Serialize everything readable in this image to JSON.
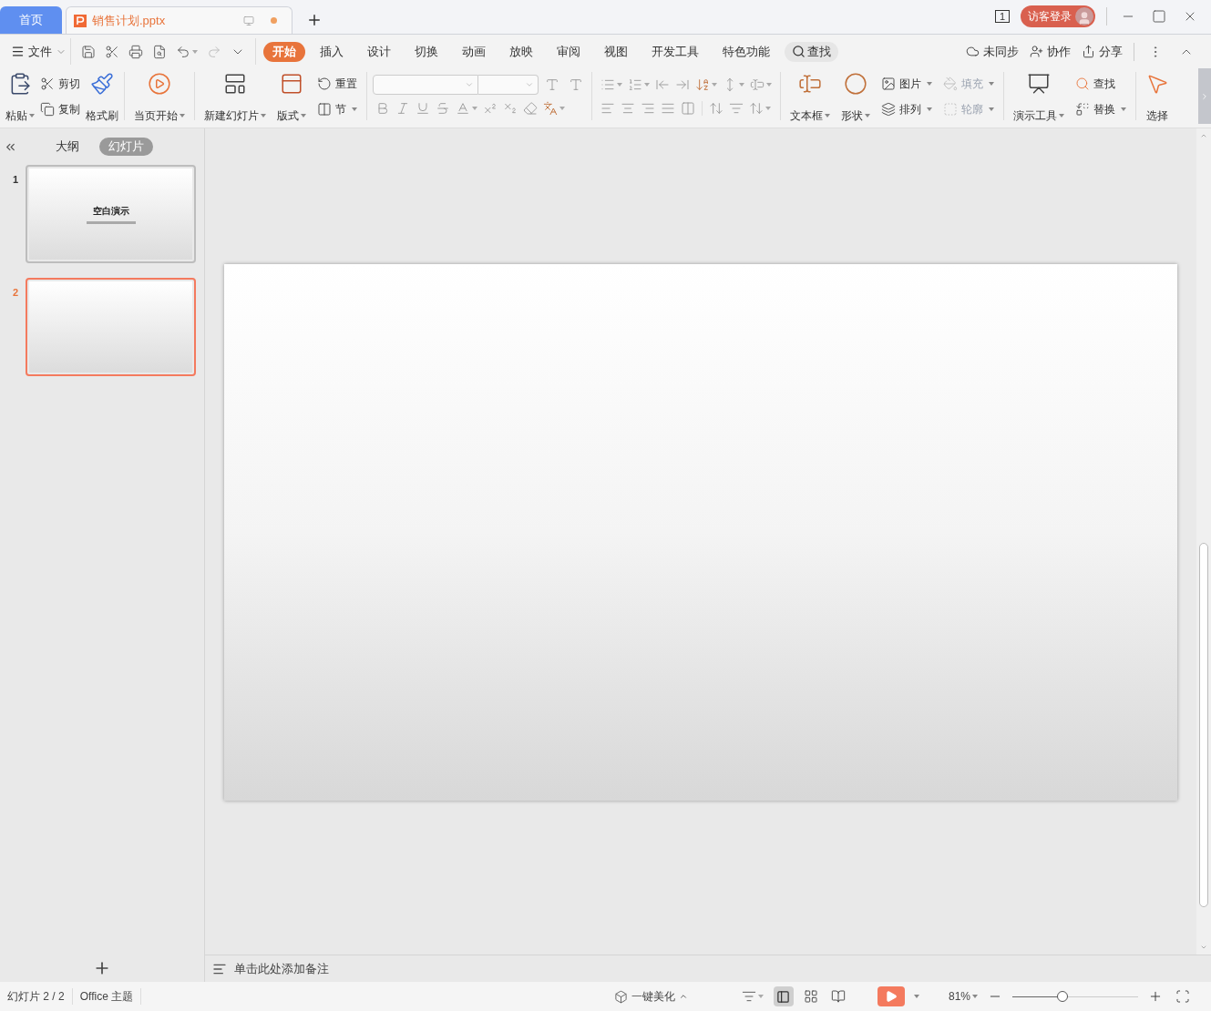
{
  "title_bar": {
    "tabs": [
      {
        "label": "首页",
        "selected": false,
        "kind": "home",
        "modified": false
      },
      {
        "label": "销售计划.pptx",
        "selected": true,
        "kind": "document",
        "modified": true
      }
    ],
    "window_count": "1",
    "login_button": "访客登录"
  },
  "menu_bar": {
    "file_menu": "文件",
    "tabs": [
      {
        "label": "开始",
        "selected": true
      },
      {
        "label": "插入",
        "selected": false
      },
      {
        "label": "设计",
        "selected": false
      },
      {
        "label": "切换",
        "selected": false
      },
      {
        "label": "动画",
        "selected": false
      },
      {
        "label": "放映",
        "selected": false
      },
      {
        "label": "审阅",
        "selected": false
      },
      {
        "label": "视图",
        "selected": false
      },
      {
        "label": "开发工具",
        "selected": false
      },
      {
        "label": "特色功能",
        "selected": false
      }
    ],
    "search": "查找",
    "actions": [
      "未同步",
      "协作",
      "分享"
    ]
  },
  "ribbon": {
    "groups": [
      {
        "items": [
          {
            "label": "粘贴",
            "dropdown": true
          },
          {
            "label": "剪切",
            "dropdown": false
          },
          {
            "label": "复制",
            "dropdown": false
          },
          {
            "label": "格式刷",
            "dropdown": false
          }
        ]
      },
      {
        "items": [
          {
            "label": "当页开始",
            "dropdown": true
          }
        ]
      },
      {
        "items": [
          {
            "label": "新建幻灯片",
            "dropdown": true
          },
          {
            "label": "版式",
            "dropdown": true
          },
          {
            "label": "重置",
            "dropdown": false
          },
          {
            "label": "节",
            "dropdown": true
          }
        ]
      },
      {
        "items": [
          {
            "label": "文本框",
            "dropdown": true,
            "disabled": false
          },
          {
            "label": "形状",
            "dropdown": true,
            "disabled": false
          },
          {
            "label": "图片",
            "dropdown": true,
            "disabled": false
          },
          {
            "label": "排列",
            "dropdown": true,
            "disabled": false
          },
          {
            "label": "填充",
            "dropdown": true,
            "disabled": true
          },
          {
            "label": "轮廓",
            "dropdown": true,
            "disabled": true
          }
        ]
      },
      {
        "items": [
          {
            "label": "演示工具",
            "dropdown": true
          },
          {
            "label": "查找",
            "dropdown": false
          },
          {
            "label": "替换",
            "dropdown": true
          },
          {
            "label": "选择",
            "dropdown": false
          }
        ]
      }
    ]
  },
  "slide_panel": {
    "view_tabs": [
      {
        "label": "大纲",
        "selected": false
      },
      {
        "label": "幻灯片",
        "selected": true
      }
    ],
    "slides": [
      {
        "number": "1",
        "title": "空白演示",
        "selected": false
      },
      {
        "number": "2",
        "selected": true
      }
    ]
  },
  "notes_placeholder": "单击此处添加备注",
  "status_bar": {
    "slide_count": "幻灯片 2 / 2",
    "theme": "Office 主题",
    "beautify": "一键美化",
    "zoom": {
      "reading": "81%",
      "level": 0.4
    }
  }
}
